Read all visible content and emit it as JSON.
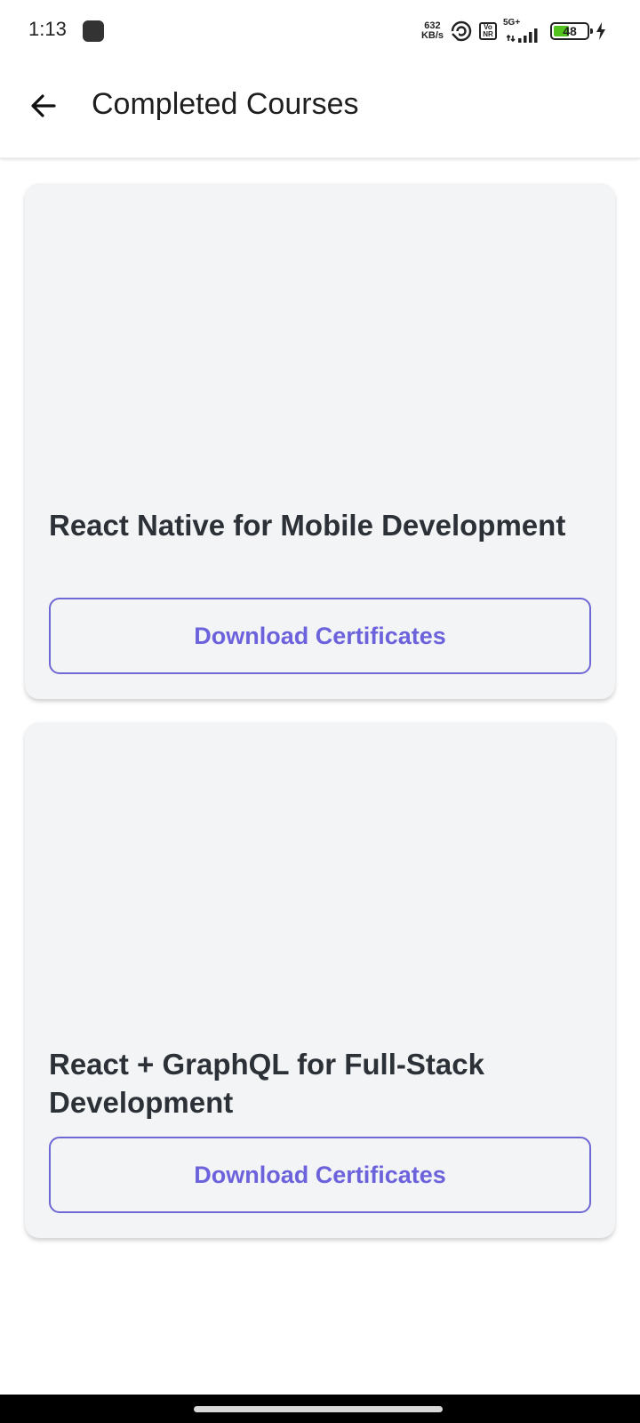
{
  "status_bar": {
    "time": "1:13",
    "net_speed_value": "632",
    "net_speed_unit": "KB/s",
    "volte_top": "Vo",
    "volte_bottom": "NR",
    "network_type": "5G+",
    "battery_level": "48",
    "battery_fraction": 0.48,
    "battery_color": "#52c21f"
  },
  "app_bar": {
    "title": "Completed Courses",
    "back_icon": "arrow-left-icon"
  },
  "courses": [
    {
      "title": "React Native for Mobile Development",
      "button_label": "Download Certificates"
    },
    {
      "title": "React + GraphQL for Full-Stack Development",
      "button_label": "Download Certificates"
    }
  ],
  "colors": {
    "accent": "#6c63dc",
    "card_background": "#f3f4f6"
  }
}
